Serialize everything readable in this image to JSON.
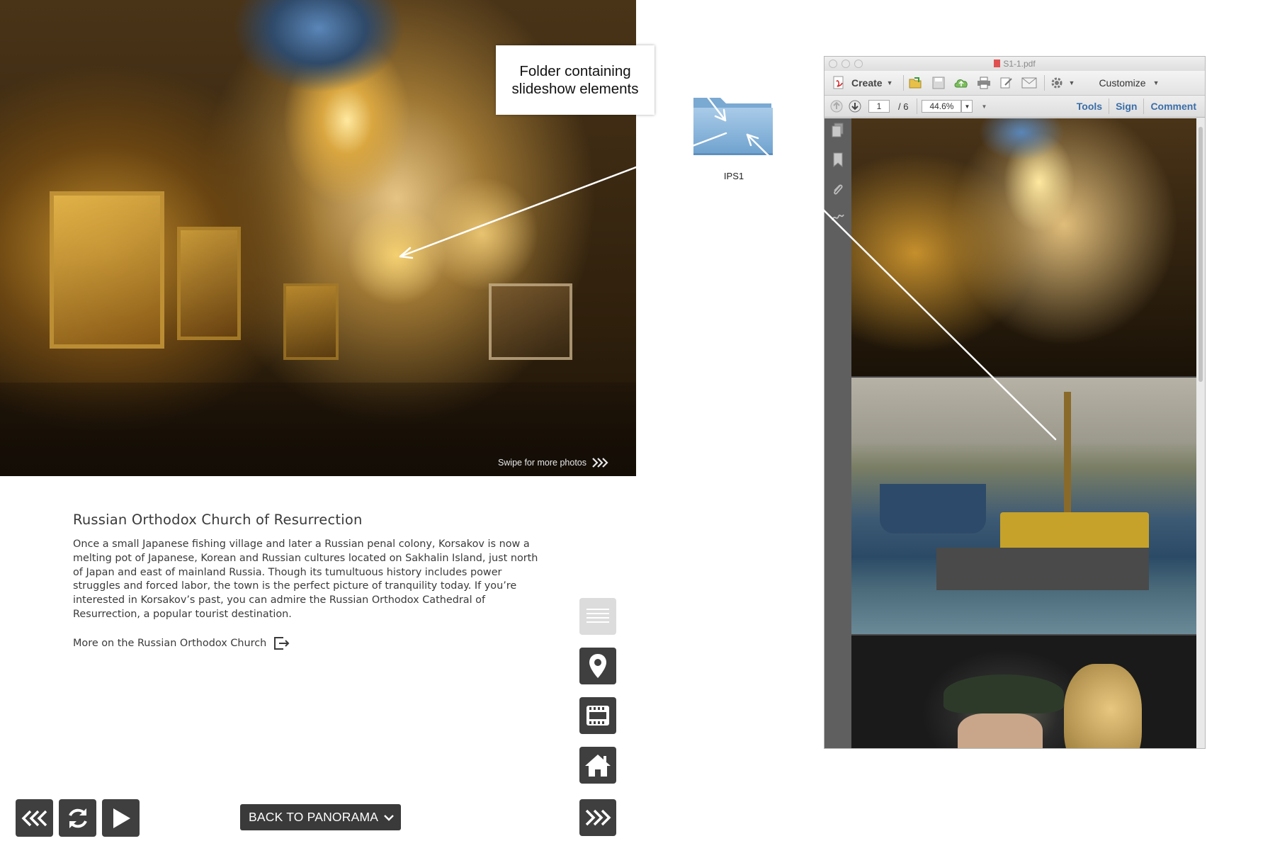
{
  "photo": {
    "caption": "Swipe for more photos",
    "caption_icon": "triple-chevron-right-icon"
  },
  "article": {
    "title": "Russian Orthodox Church of Resurrection",
    "body": "Once a small Japanese fishing village and later a Russian penal colony, Korsakov is now a melting pot of Japanese, Korean and Russian cultures located on Sakhalin Island, just north of Japan and east of mainland Russia. Though its tumultuous history includes power struggles and forced labor, the town is the perfect picture of tranquility today. If you’re interested in Korsakov’s past, you can admire the Russian Orthodox Cathedral of Resurrection, a popular tourist destination.",
    "more_link": "More on the Russian Orthodox Church",
    "more_icon": "external-link-icon"
  },
  "side_buttons": [
    {
      "icon": "text-lines-icon"
    },
    {
      "icon": "map-pin-icon"
    },
    {
      "icon": "film-strip-icon"
    },
    {
      "icon": "home-icon"
    },
    {
      "icon": "fast-forward-icon"
    }
  ],
  "bottom_nav": {
    "rewind_icon": "rewind-icon",
    "refresh_icon": "refresh-icon",
    "play_icon": "play-icon",
    "panorama_label": "BACK TO PANORAMA"
  },
  "callout": {
    "line1": "Folder containing",
    "line2": "slideshow elements"
  },
  "folder": {
    "label": "IPS1"
  },
  "pdf_window": {
    "title": "S1-1.pdf",
    "create_label": "Create",
    "customize_label": "Customize",
    "page_current": "1",
    "page_total": "/ 6",
    "zoom": "44.6%",
    "tools_label": "Tools",
    "sign_label": "Sign",
    "comment_label": "Comment"
  },
  "colors": {
    "button_dark": "#3f3f3f",
    "button_light": "#dcdcdc",
    "link_blue": "#3a6ea8"
  }
}
